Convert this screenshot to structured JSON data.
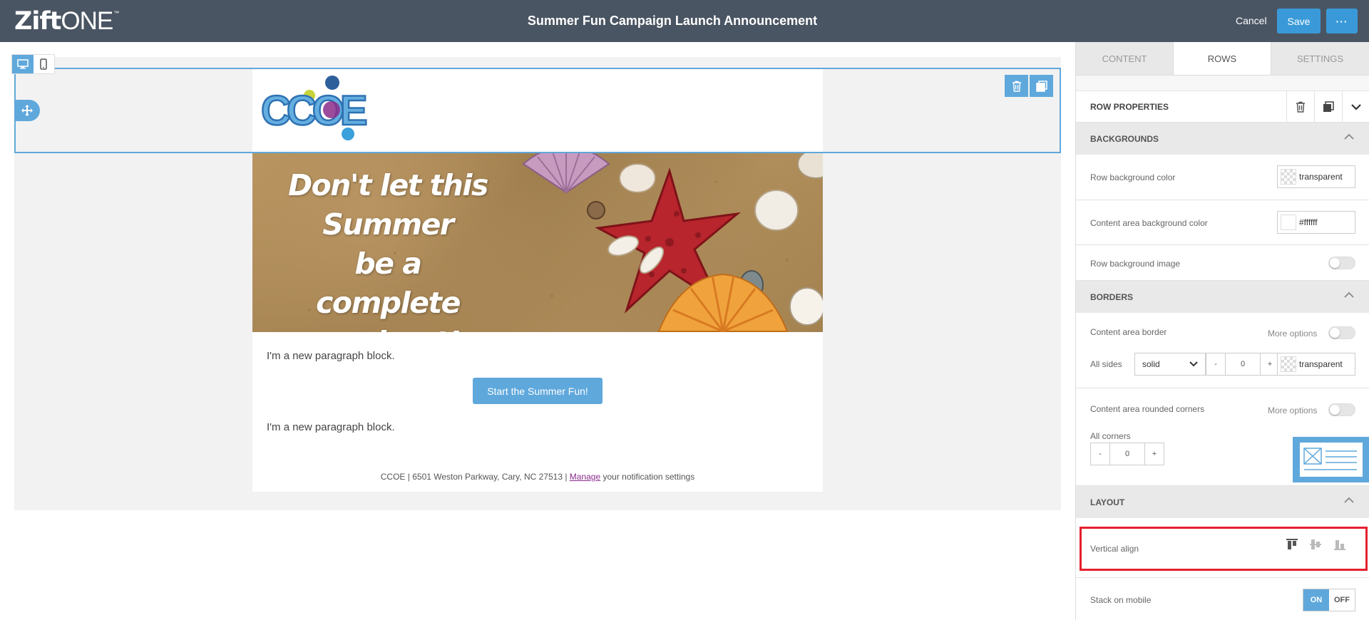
{
  "header": {
    "logo_zift": "Zift",
    "logo_one": "ONE",
    "logo_tm": "™",
    "title": "Summer Fun Campaign Launch Announcement",
    "cancel": "Cancel",
    "save": "Save",
    "more": "···"
  },
  "email": {
    "logo_text": "CCOE",
    "hero_lines": [
      "Don't let this",
      "Summer",
      "be a complete",
      "washout!"
    ],
    "paragraph1": "I'm a new paragraph block.",
    "cta": "Start the Summer Fun!",
    "paragraph2": "I'm a new paragraph block.",
    "footer_prefix": "CCOE | 6501 Weston Parkway, Cary, NC 27513 | ",
    "footer_link": "Manage",
    "footer_suffix": " your notification settings"
  },
  "panel": {
    "tabs": [
      "CONTENT",
      "ROWS",
      "SETTINGS"
    ],
    "active_tab": "ROWS",
    "row_properties": "ROW PROPERTIES",
    "backgrounds": {
      "title": "BACKGROUNDS",
      "row_bg_label": "Row background color",
      "row_bg_value": "transparent",
      "content_bg_label": "Content area background color",
      "content_bg_value": "#ffffff",
      "row_bg_image_label": "Row background image"
    },
    "borders": {
      "title": "BORDERS",
      "content_border_label": "Content area border",
      "more_options": "More options",
      "all_sides_label": "All sides",
      "style_value": "solid",
      "minus": "-",
      "width_value": "0",
      "plus": "+",
      "color_value": "transparent",
      "rounded_label": "Content area rounded corners",
      "all_corners_label": "All corners",
      "corner_value": "0"
    },
    "layout": {
      "title": "LAYOUT",
      "vertical_align_label": "Vertical align",
      "stack_mobile_label": "Stack on mobile",
      "on": "ON",
      "off": "OFF"
    }
  },
  "colors": {
    "topbar": "#4a5563",
    "accent": "#5fa8dc",
    "save": "#3a9ad9",
    "highlight": "#e5202e"
  }
}
